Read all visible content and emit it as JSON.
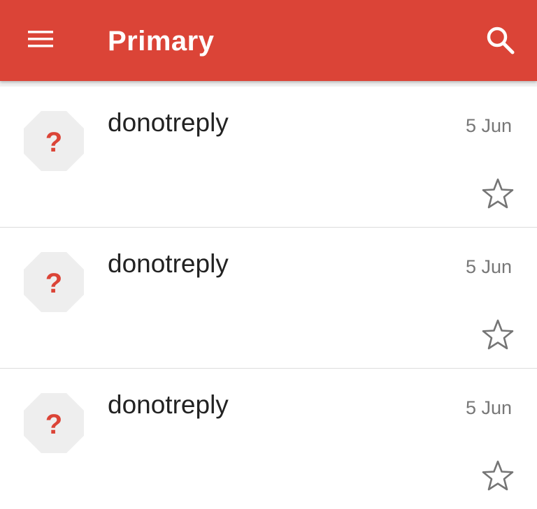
{
  "app_bar": {
    "title": "Primary",
    "menu_icon": "menu-icon",
    "search_icon": "search-icon",
    "color": "#db4437"
  },
  "emails": [
    {
      "sender": "donotreply",
      "date": "5 Jun",
      "subject": "",
      "avatar_icon": "question-mark-icon",
      "starred": false
    },
    {
      "sender": "donotreply",
      "date": "5 Jun",
      "subject": "",
      "avatar_icon": "question-mark-icon",
      "starred": false
    },
    {
      "sender": "donotreply",
      "date": "5 Jun",
      "subject": "",
      "avatar_icon": "question-mark-icon",
      "starred": false
    }
  ],
  "colors": {
    "accent": "#db4437",
    "avatar_bg": "#eeeeee",
    "avatar_glyph": "#db4437",
    "star_outline": "#757575"
  }
}
